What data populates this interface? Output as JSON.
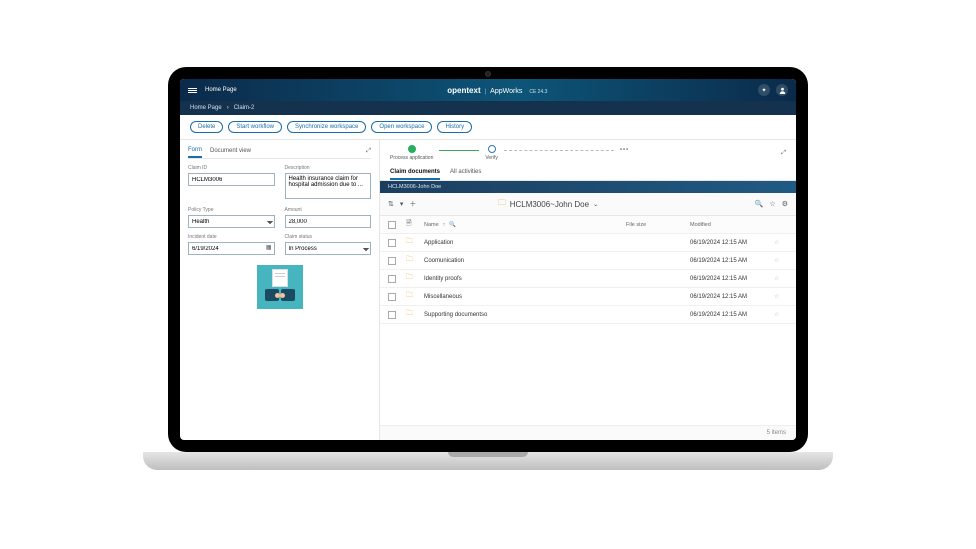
{
  "header": {
    "menu_label": "Home Page",
    "brand_opentext": "opentext",
    "brand_app": "AppWorks",
    "brand_version": "CE 24.3"
  },
  "breadcrumb": {
    "root": "Home Page",
    "current": "Claim-2"
  },
  "actions": {
    "delete": "Delete",
    "start": "Start workflow",
    "sync": "Synchronize workspace",
    "open": "Open workspace",
    "history": "History"
  },
  "tabs": {
    "form": "Form",
    "docview": "Document view"
  },
  "form": {
    "claim_id_label": "Claim ID",
    "claim_id_value": "HCLM3006",
    "description_label": "Description",
    "description_value": "Health insurance claim for hospital admission due to ...",
    "policy_type_label": "Policy Type",
    "policy_type_value": "Health",
    "amount_label": "Amount",
    "amount_value": "28,000",
    "incident_date_label": "Incident date",
    "incident_date_value": "6/19/2024",
    "claim_status_label": "Claim status",
    "claim_status_value": "In Process"
  },
  "workflow": {
    "step1": "Process application",
    "step2": "Verify"
  },
  "sub_tabs": {
    "claim_docs": "Claim documents",
    "activities": "All activities"
  },
  "folder_bar": "HCLM3006-John Doe",
  "folder_title": "HCLM3006~John Doe",
  "columns": {
    "name": "Name",
    "size": "File size",
    "modified": "Modified"
  },
  "rows": [
    {
      "name": "Application",
      "size": "",
      "modified": "06/19/2024 12:15 AM"
    },
    {
      "name": "Coomunication",
      "size": "",
      "modified": "06/19/2024 12:15 AM"
    },
    {
      "name": "Identity proofs",
      "size": "",
      "modified": "06/19/2024 12:15 AM"
    },
    {
      "name": "Miscellaneous",
      "size": "",
      "modified": "06/19/2024 12:15 AM"
    },
    {
      "name": "Supporting documentso",
      "size": "",
      "modified": "06/19/2024 12:15 AM"
    }
  ],
  "footer_count": "5 items"
}
